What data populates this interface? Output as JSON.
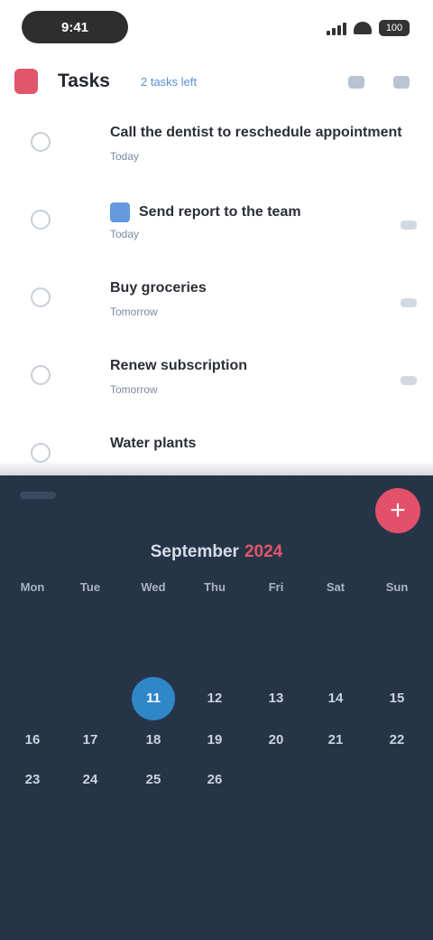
{
  "status_bar": {
    "time": "9:41",
    "battery": "100"
  },
  "header": {
    "title": "Tasks",
    "subtitle": "2 tasks left"
  },
  "tasks": [
    {
      "title": "Call the dentist to reschedule appointment",
      "subtitle": "Today",
      "has_icon": false
    },
    {
      "title": "Send report to the team",
      "subtitle": "Today",
      "has_icon": true
    },
    {
      "title": "Buy groceries",
      "subtitle": "Tomorrow",
      "has_icon": false
    },
    {
      "title": "Renew subscription",
      "subtitle": "Tomorrow",
      "has_icon": false
    },
    {
      "title": "Water plants",
      "subtitle": "",
      "has_icon": false
    }
  ],
  "calendar": {
    "month": "September",
    "year": "2024",
    "fab_label": "+",
    "weekdays": [
      "Mon",
      "Tue",
      "Wed",
      "Thu",
      "Fri",
      "Sat",
      "Sun"
    ],
    "selected_day": "11",
    "rows": [
      [
        "",
        "",
        "11",
        "12",
        "13",
        "14",
        "15"
      ],
      [
        "16",
        "17",
        "18",
        "19",
        "20",
        "21",
        "22"
      ],
      [
        "23",
        "24",
        "25",
        "26",
        "",
        "",
        ""
      ]
    ]
  },
  "colors": {
    "accent": "#e0566b",
    "calendar_bg": "#263447",
    "selected": "#2f87c8"
  }
}
